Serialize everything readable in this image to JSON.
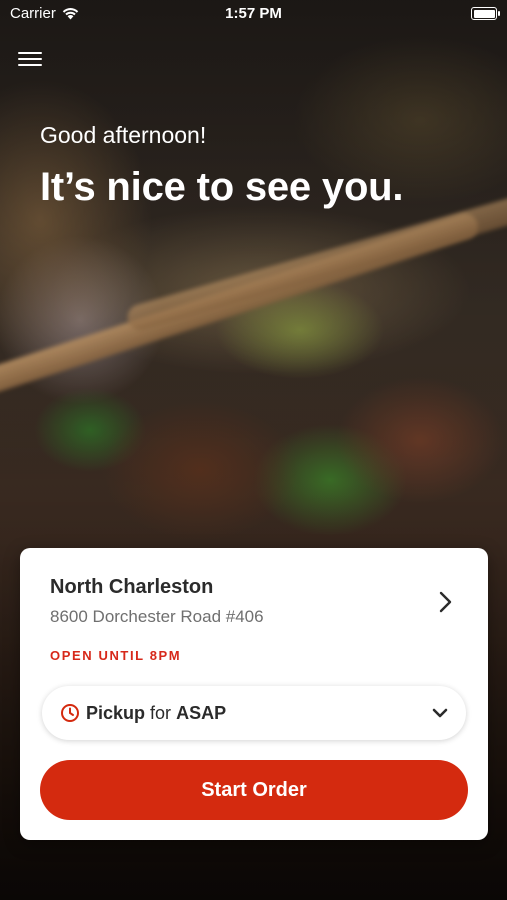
{
  "status_bar": {
    "carrier": "Carrier",
    "time": "1:57 PM",
    "battery_level": 1.0
  },
  "header": {
    "menu_icon": "hamburger-menu-icon",
    "greeting": "Good afternoon!",
    "headline": "It’s nice to see you."
  },
  "location_card": {
    "name": "North Charleston",
    "address": "8600 Dorchester Road #406",
    "hours": "OPEN UNTIL 8PM",
    "pickup": {
      "mode": "Pickup",
      "connector": "for",
      "time": "ASAP"
    },
    "start_order_label": "Start Order"
  },
  "colors": {
    "accent": "#d42a0f",
    "hours_text": "#d7281a",
    "card_bg": "#ffffff"
  }
}
